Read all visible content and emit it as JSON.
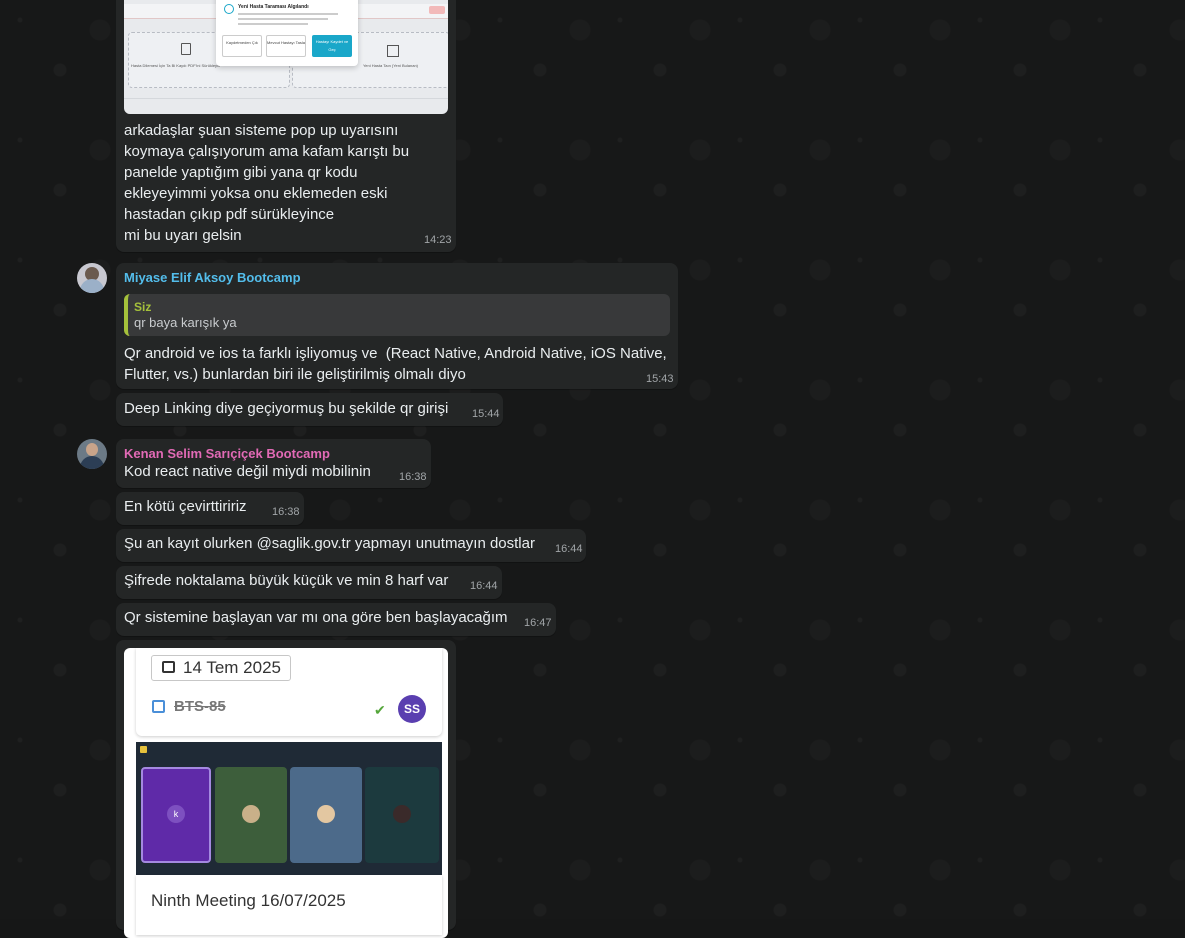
{
  "messages": {
    "m1": {
      "text": "arkadaşlar şuan sisteme pop up uyarısını\nkoymaya çalışıyorum ama kafam karıştı bu\npanelde yaptığım gibi yana qr kodu\nekleyeyimmi yoksa onu eklemeden eski\nhastadan çıkıp pdf sürükleyince\nmi bu uyarı gelsin",
      "time": "14:23"
    },
    "m2": {
      "sender": "Miyase Elif Aksoy Bootcamp",
      "quote_sender": "Siz",
      "quote_text": "qr baya karışık ya",
      "text": "Qr android ve ios ta farklı işliyomuş ve  (React Native, Android Native, iOS Native,\nFlutter, vs.) bunlardan biri ile geliştirilmiş olmalı diyo",
      "time": "15:43"
    },
    "m3": {
      "text": "Deep Linking diye geçiyormuş bu şekilde qr girişi",
      "time": "15:44"
    },
    "m4": {
      "sender": "Kenan Selim Sarıçiçek Bootcamp",
      "text": "Kod react native değil miydi mobilinin",
      "time": "16:38"
    },
    "m5": {
      "text": "En kötü çevirttiririz",
      "time": "16:38"
    },
    "m6": {
      "text": "Şu an kayıt olurken @saglik.gov.tr yapmayı unutmayın dostlar",
      "time": "16:44"
    },
    "m7": {
      "text": "Şifrede noktalama büyük küçük ve min 8 harf var",
      "time": "16:44"
    },
    "m8": {
      "text": "Qr sistemine başlayan var mı ona göre ben başlayacağım",
      "time": "16:47"
    }
  },
  "screenshot1": {
    "dialog_title": "Yeni Hasta Taraması Algılandı",
    "btn_left": "Kaydetmeden Çık",
    "btn_mid": "Mevcut Hastayı Tasla",
    "btn_right": "Hastayı Kaydet ve Geç",
    "left_card": "Hasta Dilemesi İçin Ta Bi Kaydı PDF'ini Sürükleyin",
    "right_card": "Yeni Hasta Taın (Yeni Bulanan)"
  },
  "screenshot2": {
    "date": "14 Tem 2025",
    "task": "BTS-85",
    "avatar_initials": "SS",
    "tile_letter": "k",
    "meeting_title": "Ninth Meeting 16/07/2025"
  },
  "colors": {
    "bubble": "#242626",
    "sender_miyase": "#53bdeb",
    "sender_kenan": "#e26ab6",
    "quote_accent": "#a5c13b"
  }
}
